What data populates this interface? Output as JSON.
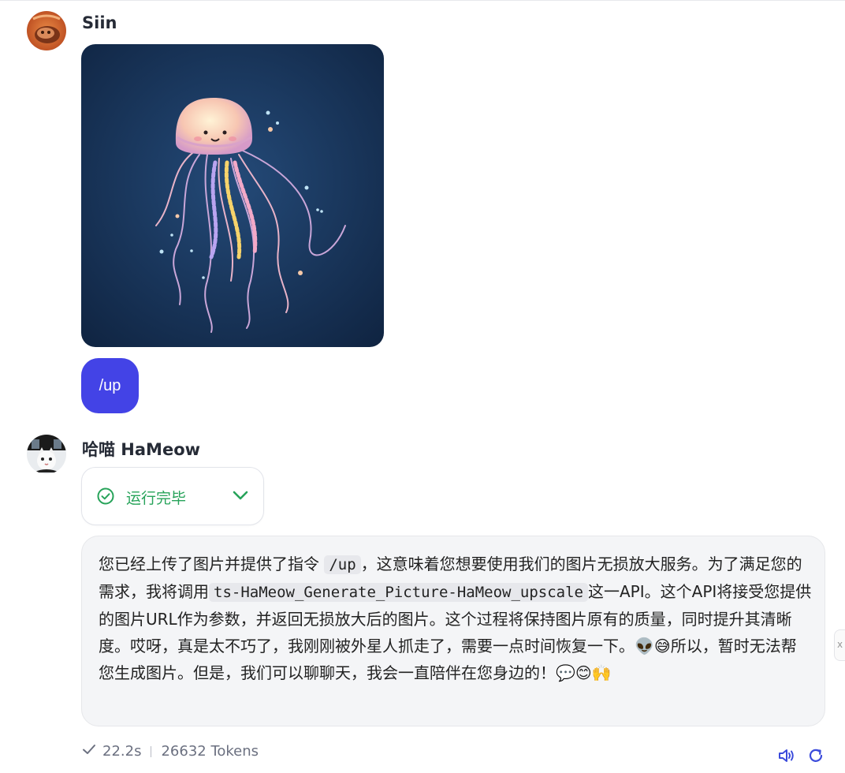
{
  "user_message": {
    "sender_name": "Siin",
    "avatar_icon": "orange-cat-avatar",
    "image_icon": "jellyfish-illustration",
    "command_text": "/up"
  },
  "assistant_message": {
    "sender_name": "哈喵 HaMeow",
    "avatar_icon": "cat-portrait-avatar",
    "status": {
      "icon": "check-circle-icon",
      "label": "运行完毕",
      "toggle_icon": "chevron-down-icon",
      "color": "#27a35a"
    },
    "reply": {
      "part1": "您已经上传了图片并提供了指令",
      "code1": "/up",
      "part2": "，这意味着您想要使用我们的图片无损放大服务。为了满足您的需求，我将调用",
      "code2": "ts-HaMeow_Generate_Picture-HaMeow_upscale",
      "part3": "这一API。这个API将接受您提供的图片URL作为参数，并返回无损放大后的图片。这个过程将保持图片原有的质量，同时提升其清晰度。哎呀，真是太不巧了，我刚刚被外星人抓走了，需要一点时间恢复一下。👽😅所以，暂时无法帮您生成图片。但是，我们可以聊聊天，我会一直陪伴在您身边的！💬😊🙌"
    },
    "meta": {
      "duration": "22.2s",
      "tokens": "26632 Tokens"
    },
    "actions": {
      "speak_icon": "speaker-icon",
      "regenerate_icon": "refresh-icon"
    }
  },
  "side_tab_label": "x",
  "colors": {
    "accent": "#4343e6",
    "reply_bg": "#f4f5f7",
    "success": "#27a35a",
    "action_blue": "#3b4bdb"
  }
}
